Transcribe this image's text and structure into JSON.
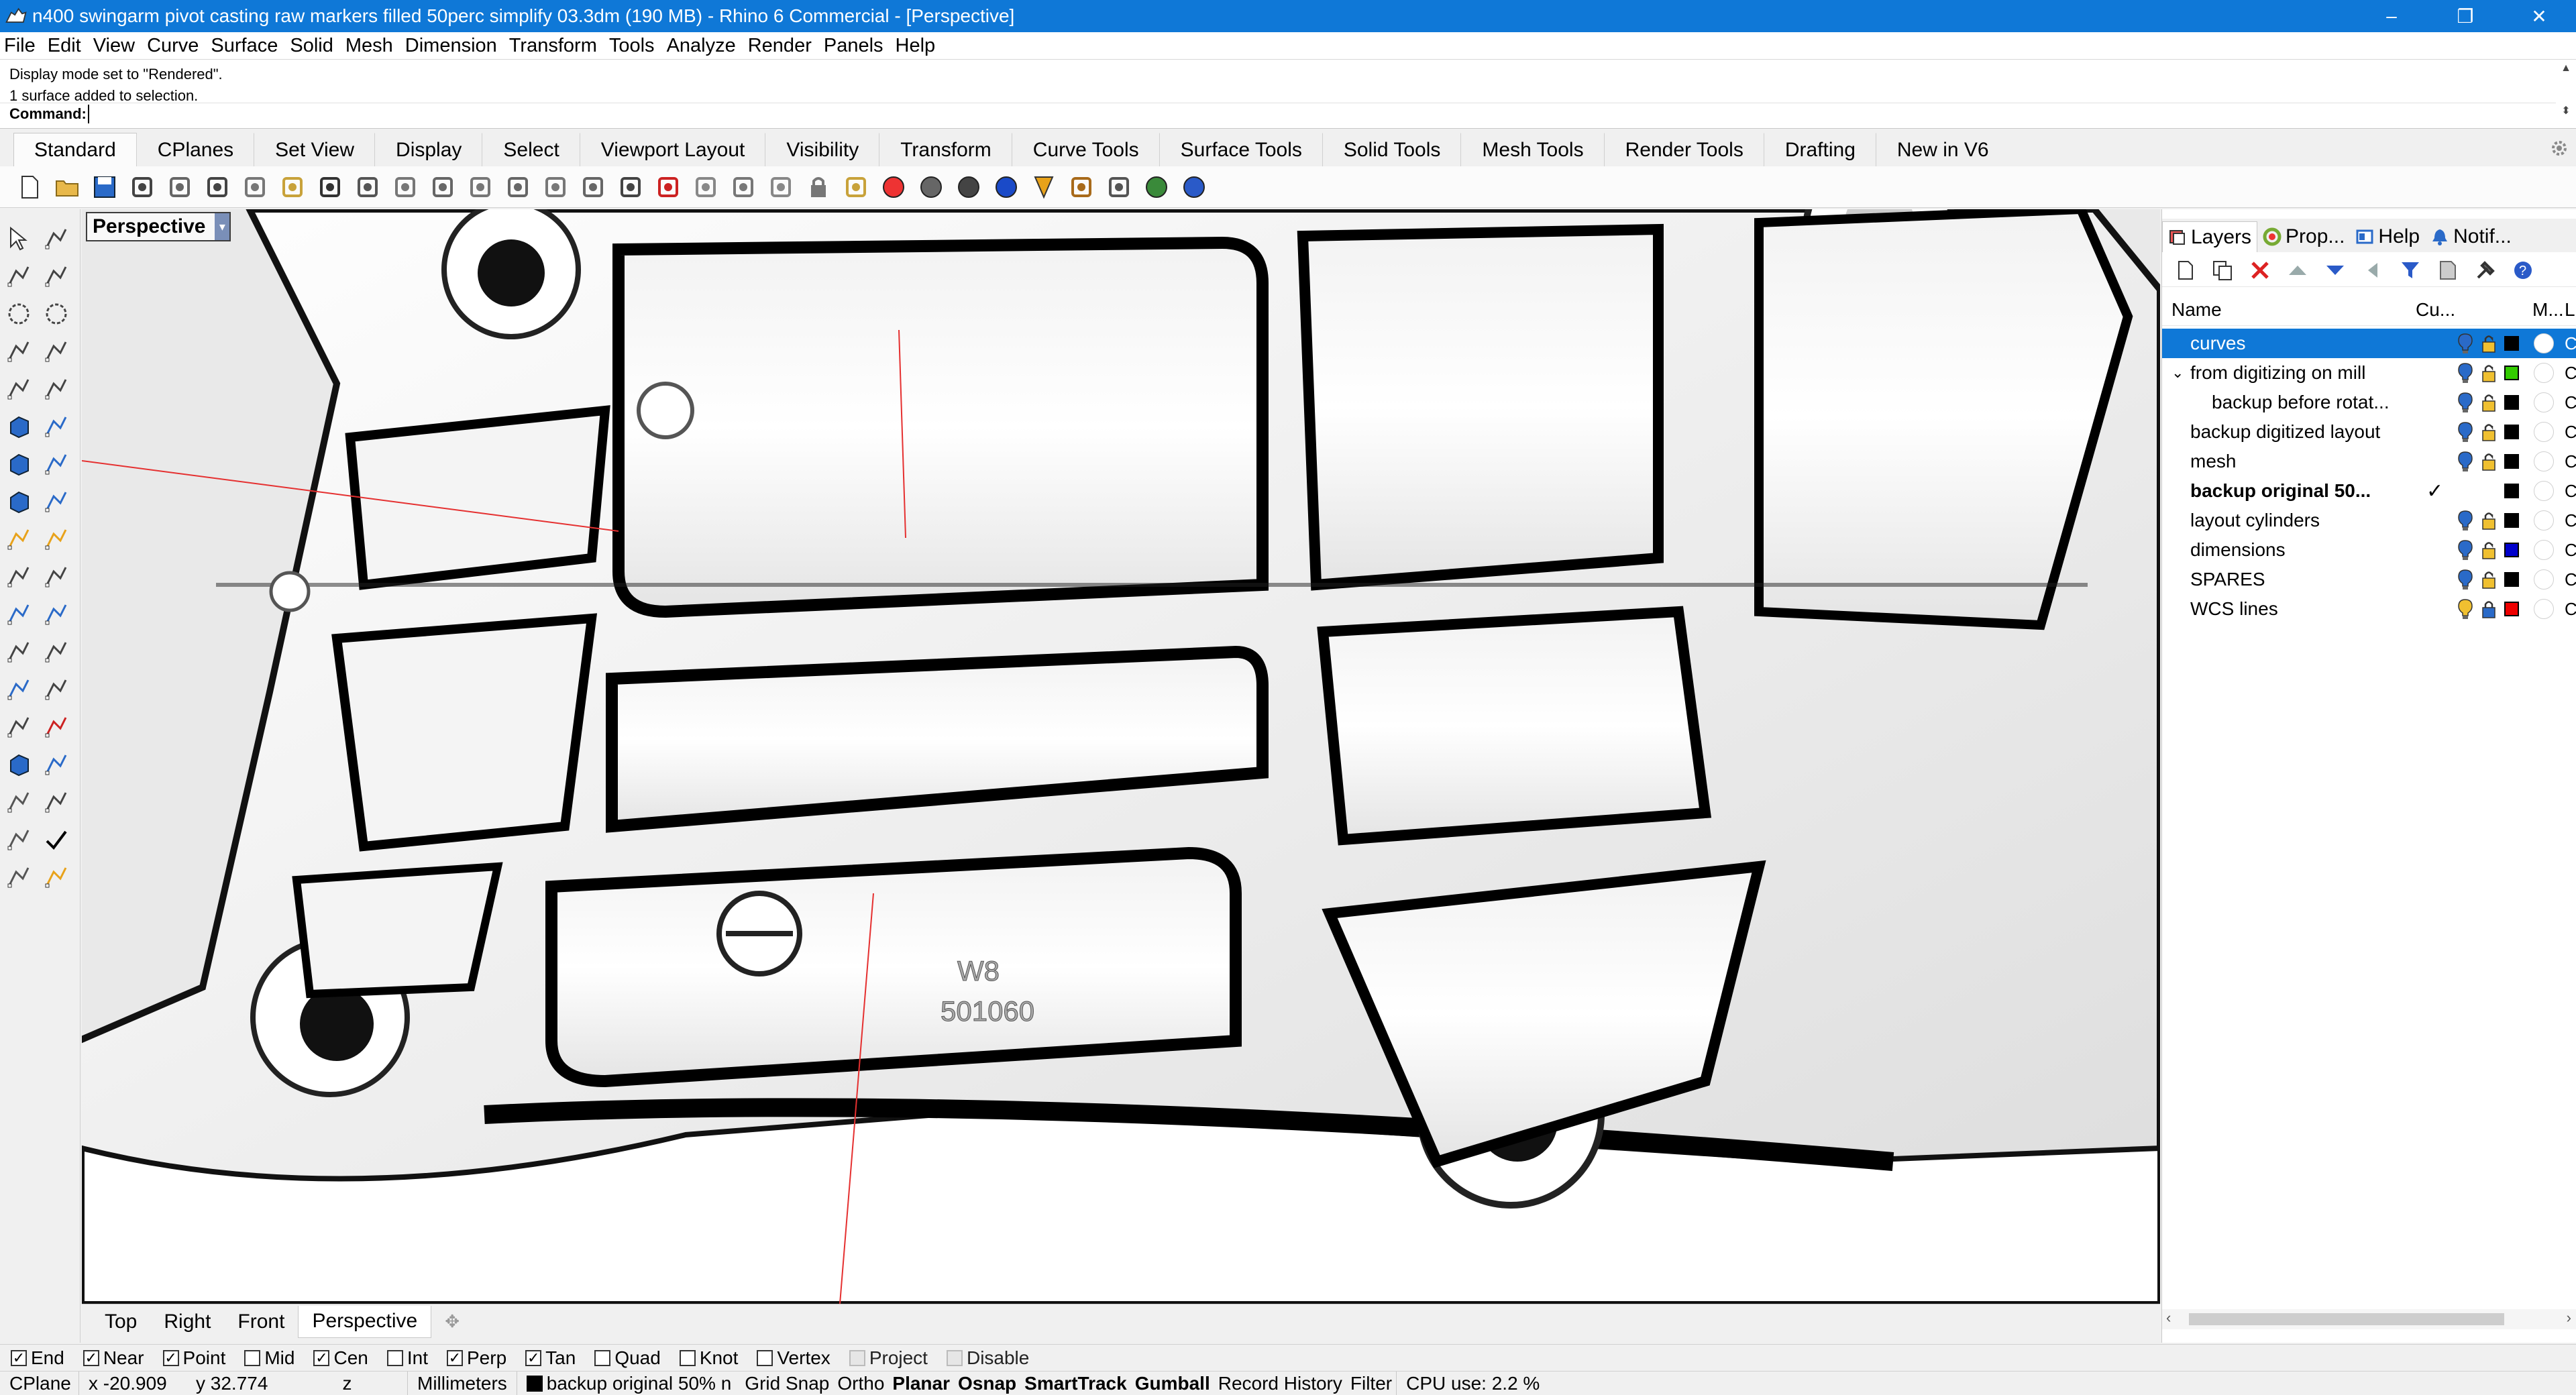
{
  "window": {
    "title": "n400 swingarm pivot casting raw markers filled 50perc simplify 03.3dm (190 MB) - Rhino 6 Commercial - [Perspective]",
    "controls": {
      "minimize": "–",
      "maximize": "❐",
      "close": "✕"
    }
  },
  "menu": [
    "File",
    "Edit",
    "View",
    "Curve",
    "Surface",
    "Solid",
    "Mesh",
    "Dimension",
    "Transform",
    "Tools",
    "Analyze",
    "Render",
    "Panels",
    "Help"
  ],
  "command": {
    "history": [
      "Display mode set to \"Rendered\".",
      "1 surface added to selection."
    ],
    "prompt": "Command:",
    "value": ""
  },
  "toolbar_tabs": [
    "Standard",
    "CPlanes",
    "Set View",
    "Display",
    "Select",
    "Viewport Layout",
    "Visibility",
    "Transform",
    "Curve Tools",
    "Surface Tools",
    "Solid Tools",
    "Mesh Tools",
    "Render Tools",
    "Drafting",
    "New in V6"
  ],
  "active_toolbar_tab": "Standard",
  "standard_tools": [
    "new-icon",
    "open-icon",
    "save-icon",
    "print-icon",
    "import-icon",
    "cut-icon",
    "copy-icon",
    "paste-icon",
    "undo-icon",
    "pan-icon",
    "move-view-icon",
    "zoom-icon",
    "zoom-window-icon",
    "zoom-extents-icon",
    "zoom-selected-icon",
    "rotate-view-icon",
    "viewport-layout-icon",
    "car-icon",
    "split-icon",
    "hide-icon",
    "show-icon",
    "lock-icon",
    "layer-icon",
    "color-wheel-icon",
    "shaded-sphere-icon",
    "rendered-sphere-icon",
    "blue-sphere-icon",
    "light-icon",
    "gear-tool-icon",
    "dimension-icon",
    "globe-icon",
    "help-icon"
  ],
  "viewport": {
    "label": "Perspective",
    "tabs": [
      "Top",
      "Right",
      "Front",
      "Perspective"
    ],
    "active_tab": "Perspective",
    "stamped_text": [
      "W8",
      "501060"
    ]
  },
  "panel": {
    "tabs": [
      {
        "label": "Layers",
        "icon": "layers-icon"
      },
      {
        "label": "Prop...",
        "icon": "properties-icon"
      },
      {
        "label": "Help",
        "icon": "help-panel-icon"
      },
      {
        "label": "Notif...",
        "icon": "notifications-icon"
      }
    ],
    "columns": {
      "name": "Name",
      "current": "Cu...",
      "material": "M...",
      "linetype": "L"
    },
    "layers": [
      {
        "name": "curves",
        "indent": 0,
        "selected": true,
        "color": "#000000",
        "bulb": "on",
        "lock": "unlocked",
        "current": false,
        "bold": false,
        "expander": ""
      },
      {
        "name": "from digitizing on mill",
        "indent": 0,
        "selected": false,
        "color": "#33cc00",
        "bulb": "on",
        "lock": "unlocked",
        "current": false,
        "bold": false,
        "expander": "⌄"
      },
      {
        "name": "backup before rotat...",
        "indent": 1,
        "selected": false,
        "color": "#000000",
        "bulb": "on",
        "lock": "unlocked",
        "current": false,
        "bold": false,
        "expander": ""
      },
      {
        "name": "backup digitized layout",
        "indent": 0,
        "selected": false,
        "color": "#000000",
        "bulb": "on",
        "lock": "unlocked",
        "current": false,
        "bold": false,
        "expander": ""
      },
      {
        "name": "mesh",
        "indent": 0,
        "selected": false,
        "color": "#000000",
        "bulb": "on",
        "lock": "unlocked",
        "current": false,
        "bold": false,
        "expander": ""
      },
      {
        "name": "backup original 50...",
        "indent": 0,
        "selected": false,
        "color": "#000000",
        "bulb": "none",
        "lock": "none",
        "current": true,
        "bold": true,
        "expander": ""
      },
      {
        "name": "layout cylinders",
        "indent": 0,
        "selected": false,
        "color": "#000000",
        "bulb": "on",
        "lock": "unlocked",
        "current": false,
        "bold": false,
        "expander": ""
      },
      {
        "name": "dimensions",
        "indent": 0,
        "selected": false,
        "color": "#0000cc",
        "bulb": "on",
        "lock": "unlocked",
        "current": false,
        "bold": false,
        "expander": ""
      },
      {
        "name": "SPARES",
        "indent": 0,
        "selected": false,
        "color": "#000000",
        "bulb": "on",
        "lock": "unlocked",
        "current": false,
        "bold": false,
        "expander": ""
      },
      {
        "name": "WCS lines",
        "indent": 0,
        "selected": false,
        "color": "#ee0000",
        "bulb": "off",
        "lock": "locked",
        "current": false,
        "bold": false,
        "expander": ""
      }
    ]
  },
  "osnaps": [
    {
      "label": "End",
      "checked": true,
      "enabled": true
    },
    {
      "label": "Near",
      "checked": true,
      "enabled": true
    },
    {
      "label": "Point",
      "checked": true,
      "enabled": true
    },
    {
      "label": "Mid",
      "checked": false,
      "enabled": true
    },
    {
      "label": "Cen",
      "checked": true,
      "enabled": true
    },
    {
      "label": "Int",
      "checked": false,
      "enabled": true
    },
    {
      "label": "Perp",
      "checked": true,
      "enabled": true
    },
    {
      "label": "Tan",
      "checked": true,
      "enabled": true
    },
    {
      "label": "Quad",
      "checked": false,
      "enabled": true
    },
    {
      "label": "Knot",
      "checked": false,
      "enabled": true
    },
    {
      "label": "Vertex",
      "checked": false,
      "enabled": true
    },
    {
      "label": "Project",
      "checked": false,
      "enabled": false
    },
    {
      "label": "Disable",
      "checked": false,
      "enabled": false
    }
  ],
  "status": {
    "cplane": "CPlane",
    "x": "x -20.909",
    "y": "y 32.774",
    "z": "z",
    "units": "Millimeters",
    "layer": "backup original 50% n",
    "toggles": [
      {
        "label": "Grid Snap",
        "on": false
      },
      {
        "label": "Ortho",
        "on": false
      },
      {
        "label": "Planar",
        "on": true
      },
      {
        "label": "Osnap",
        "on": true
      },
      {
        "label": "SmartTrack",
        "on": true
      },
      {
        "label": "Gumball",
        "on": true
      },
      {
        "label": "Record History",
        "on": false
      },
      {
        "label": "Filter",
        "on": false
      }
    ],
    "cpu": "CPU use: 2.2 %"
  }
}
